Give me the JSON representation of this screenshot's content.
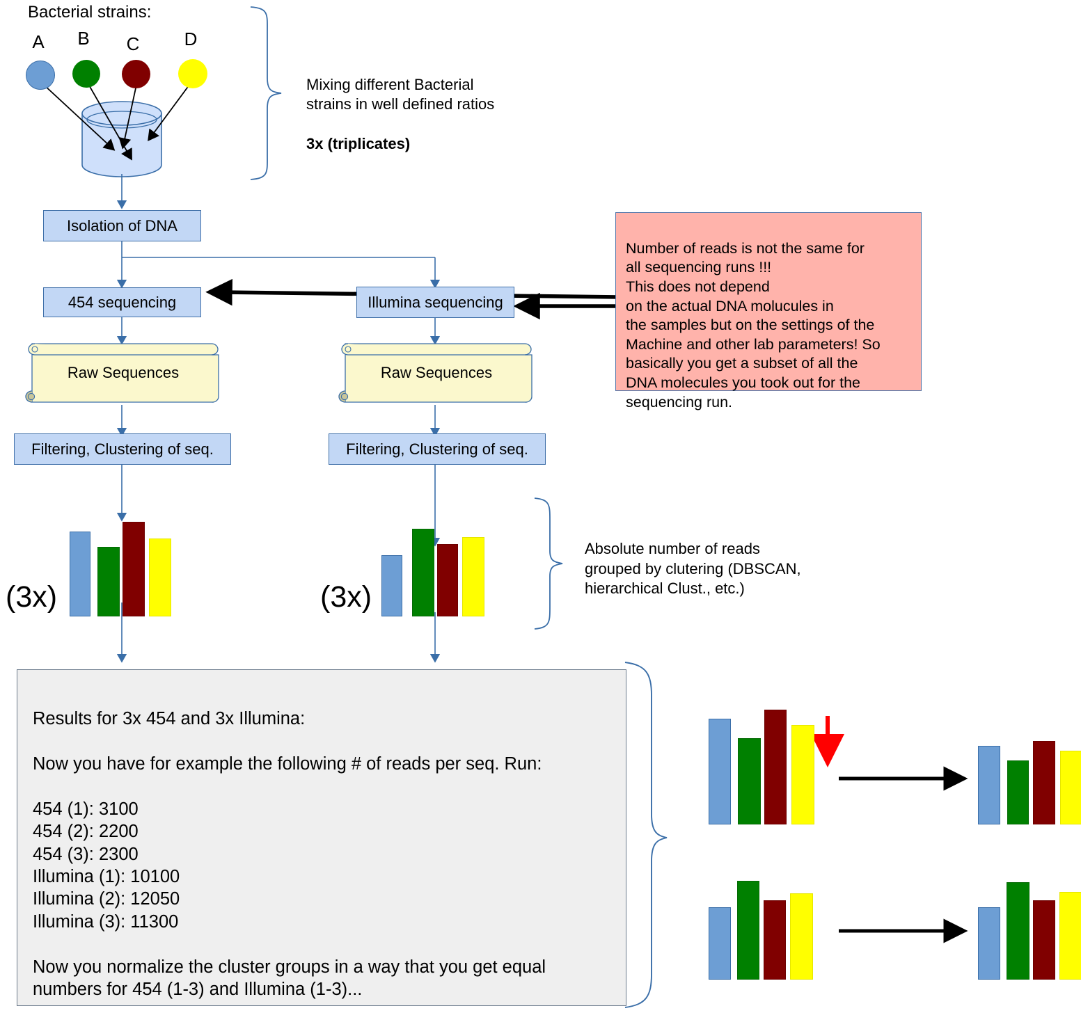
{
  "header": {
    "strains_label": "Bacterial strains:",
    "strain_letters": [
      "A",
      "B",
      "C",
      "D"
    ],
    "strain_colors": [
      "#6d9ed4",
      "#008000",
      "#800000",
      "#ffff00"
    ]
  },
  "annotations": {
    "mixing": "Mixing different Bacterial\nstrains in well defined ratios",
    "mixing_bold": "3x (triplicates)",
    "absolute_reads": "Absolute number of reads\ngrouped by clutering (DBSCAN,\nhierarchical Clust., etc.)"
  },
  "flow": {
    "isolation": "Isolation of DNA",
    "seq_454": "454 sequencing",
    "seq_illumina": "Illumina sequencing",
    "raw_left": "Raw Sequences",
    "raw_right": "Raw Sequences",
    "filter_left": "Filtering, Clustering of seq.",
    "filter_right": "Filtering, Clustering of seq.",
    "triplicate_left": "(3x)",
    "triplicate_right": "(3x)"
  },
  "pink_note": {
    "text": "Number of reads is not the same for\nall sequencing runs !!!\nThis does not depend\non the actual DNA molucules in\nthe samples but on the settings of the\nMachine and other lab parameters! So\nbasically you get a subset of all the\nDNA molecules you took out for the\nsequencing run.",
    "background": "#ffb3ab"
  },
  "results": {
    "text": "Results for 3x 454 and 3x Illumina:\n\nNow you have for example the following # of reads per seq. Run:\n\n454 (1): 3100\n454 (2): 2200\n454 (3): 2300\nIllumina (1): 10100\nIllumina (2): 12050\nIllumina (3): 11300\n\nNow you normalize the cluster groups in a way that you get equal\nnumbers for 454 (1-3) and Illumina (1-3)...",
    "title": "Results for 3x 454 and 3x Illumina:",
    "intro": "Now you have for example the following # of reads per seq. Run:",
    "read_counts": [
      {
        "run": "454 (1)",
        "reads": 3100
      },
      {
        "run": "454 (2)",
        "reads": 2200
      },
      {
        "run": "454 (3)",
        "reads": 2300
      },
      {
        "run": "Illumina (1)",
        "reads": 10100
      },
      {
        "run": "Illumina (2)",
        "reads": 12050
      },
      {
        "run": "Illumina (3)",
        "reads": 11300
      }
    ],
    "closing": "Now you normalize the cluster groups in a way that you get equal\nnumbers for 454 (1-3) and Illumina (1-3)..."
  },
  "chart_data": [
    {
      "id": "chart-454-clustered",
      "type": "bar",
      "title": "454 clustered reads",
      "categories": [
        "A",
        "B",
        "C",
        "D"
      ],
      "values": [
        110,
        88,
        122,
        100
      ],
      "colors": [
        "#6d9ed4",
        "#008000",
        "#800000",
        "#ffff00"
      ],
      "ylim": [
        0,
        130
      ]
    },
    {
      "id": "chart-illumina-clustered",
      "type": "bar",
      "title": "Illumina clustered reads",
      "categories": [
        "A",
        "B",
        "C",
        "D"
      ],
      "values": [
        66,
        100,
        80,
        90
      ],
      "colors": [
        "#6d9ed4",
        "#008000",
        "#800000",
        "#ffff00"
      ],
      "ylim": [
        0,
        130
      ]
    },
    {
      "id": "chart-454-before-normalization",
      "type": "bar",
      "title": "454 before normalization",
      "categories": [
        "A",
        "B",
        "C",
        "D"
      ],
      "values": [
        138,
        110,
        150,
        128
      ],
      "colors": [
        "#6d9ed4",
        "#008000",
        "#800000",
        "#ffff00"
      ],
      "ylim": [
        0,
        160
      ]
    },
    {
      "id": "chart-454-after-normalization",
      "type": "bar",
      "title": "454 after normalization",
      "categories": [
        "A",
        "B",
        "C",
        "D"
      ],
      "values": [
        100,
        78,
        110,
        92
      ],
      "colors": [
        "#6d9ed4",
        "#008000",
        "#800000",
        "#ffff00"
      ],
      "ylim": [
        0,
        160
      ]
    },
    {
      "id": "chart-illumina-before-normalization",
      "type": "bar",
      "title": "Illumina before normalization",
      "categories": [
        "A",
        "B",
        "C",
        "D"
      ],
      "values": [
        95,
        130,
        105,
        115
      ],
      "colors": [
        "#6d9ed4",
        "#008000",
        "#800000",
        "#ffff00"
      ],
      "ylim": [
        0,
        160
      ]
    },
    {
      "id": "chart-illumina-after-normalization",
      "type": "bar",
      "title": "Illumina after normalization",
      "categories": [
        "A",
        "B",
        "C",
        "D"
      ],
      "values": [
        95,
        130,
        105,
        118
      ],
      "colors": [
        "#6d9ed4",
        "#008000",
        "#800000",
        "#ffff00"
      ],
      "ylim": [
        0,
        160
      ]
    }
  ]
}
